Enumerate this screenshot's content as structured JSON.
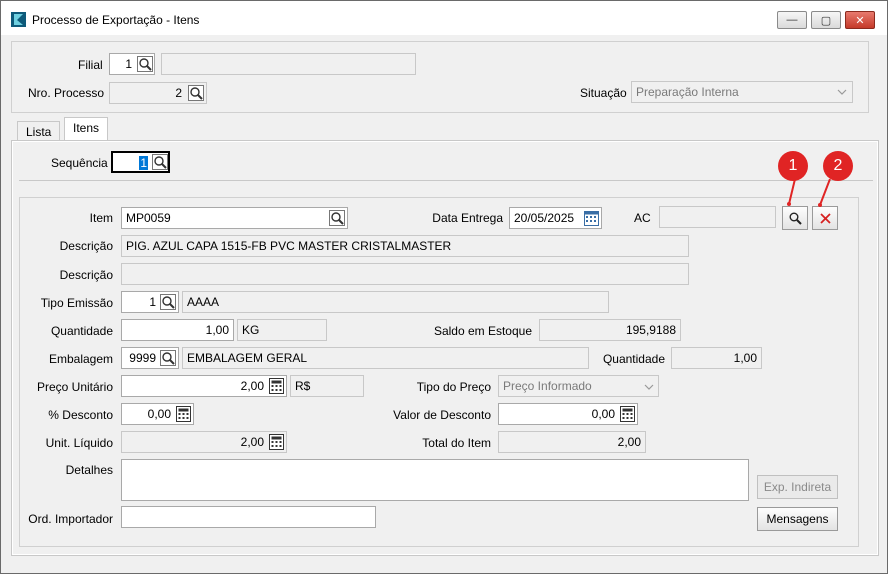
{
  "window": {
    "title": "Processo de Exportação - Itens",
    "minimize": "—",
    "maximize": "▢",
    "close": "✕"
  },
  "header": {
    "filial_label": "Filial",
    "filial_code": "1",
    "filial_name": "",
    "nro_processo_label": "Nro. Processo",
    "nro_processo_value": "2",
    "situacao_label": "Situação",
    "situacao_value": "Preparação Interna"
  },
  "tabs": [
    {
      "label": "Lista"
    },
    {
      "label": "Itens"
    }
  ],
  "sequencia": {
    "label": "Sequência",
    "value": "1"
  },
  "form": {
    "item_label": "Item",
    "item_value": "MP0059",
    "data_entrega_label": "Data Entrega",
    "data_entrega_value": "20/05/2025",
    "ac_label": "AC",
    "ac_value": "",
    "descricao_label": "Descrição",
    "descricao_value": "PIG. AZUL CAPA 1515-FB PVC MASTER CRISTALMASTER",
    "descricao2_label": "Descrição",
    "descricao2_value": "",
    "tipo_emissao_label": "Tipo Emissão",
    "tipo_emissao_code": "1",
    "tipo_emissao_name": "AAAA",
    "quantidade_label": "Quantidade",
    "quantidade_value": "1,00",
    "quantidade_unit": "KG",
    "saldo_label": "Saldo em Estoque",
    "saldo_value": "195,9188",
    "embalagem_label": "Embalagem",
    "embalagem_code": "9999",
    "embalagem_name": "EMBALAGEM GERAL",
    "emb_quantidade_label": "Quantidade",
    "emb_quantidade_value": "1,00",
    "preco_label": "Preço Unitário",
    "preco_value": "2,00",
    "preco_currency": "R$",
    "tipo_preco_label": "Tipo do Preço",
    "tipo_preco_value": "Preço Informado",
    "desconto_pct_label": "% Desconto",
    "desconto_pct_value": "0,00",
    "valor_desconto_label": "Valor de Desconto",
    "valor_desconto_value": "0,00",
    "unit_liquido_label": "Unit. Líquido",
    "unit_liquido_value": "2,00",
    "total_item_label": "Total do Item",
    "total_item_value": "2,00",
    "detalhes_label": "Detalhes",
    "detalhes_value": "",
    "ord_importador_label": "Ord. Importador",
    "ord_importador_value": ""
  },
  "buttons": {
    "exp_indireta": "Exp. Indireta",
    "mensagens": "Mensagens"
  },
  "annotations": [
    {
      "label": "1"
    },
    {
      "label": "2"
    }
  ],
  "colors": {
    "badge": "#e02424",
    "selection": "#0078d7",
    "clear_x": "#d62020"
  }
}
